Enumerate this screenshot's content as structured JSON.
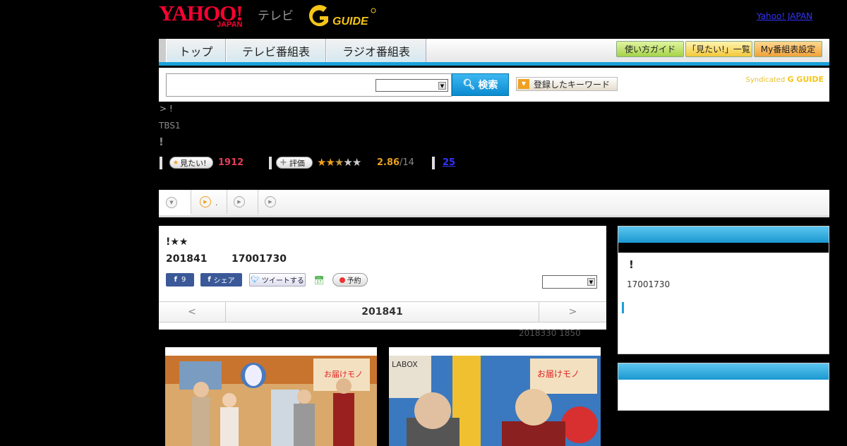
{
  "header": {
    "yahoo_logo": "YAHOO!",
    "yahoo_sub": "JAPAN",
    "tv_label": "テレビ",
    "gguide_logo": "G-GUIDE",
    "yahoo_japan_link": "Yahoo! JAPAN"
  },
  "nav": {
    "tabs": [
      "トップ",
      "テレビ番組表",
      "ラジオ番組表"
    ],
    "tools": [
      "使い方ガイド",
      "「見たい!」一覧",
      "My番組表設定"
    ]
  },
  "search": {
    "placeholder": "",
    "select_value": "",
    "button_label": "検索",
    "keyword_button": "登録したキーワード",
    "syndicated_label": "Syndicated",
    "syndicated_logo": "G GUIDE"
  },
  "program": {
    "breadcrumb": "> !",
    "channel": "TBS1",
    "title_mark": "!",
    "mitai_label": "見たい!",
    "mitai_count": "1912",
    "review_label": "評価",
    "rating_value": "2.86",
    "rating_count": "/14",
    "comments_count": "25"
  },
  "main": {
    "title": "!★★",
    "date": "201841",
    "time": "17001730",
    "share_count": "9",
    "share_label": "シェア",
    "tweet_label": "ツイートする",
    "reserve_label": "予約",
    "prev_label": "<",
    "next_label": ">",
    "nav_date": "201841",
    "updated": "2018330  1850"
  },
  "side": {
    "title": "!",
    "time": "17001730"
  },
  "colors": {
    "accent_blue": "#1aa0d8",
    "mitai_red": "#e23d5a",
    "rating_orange": "#e8a020"
  }
}
